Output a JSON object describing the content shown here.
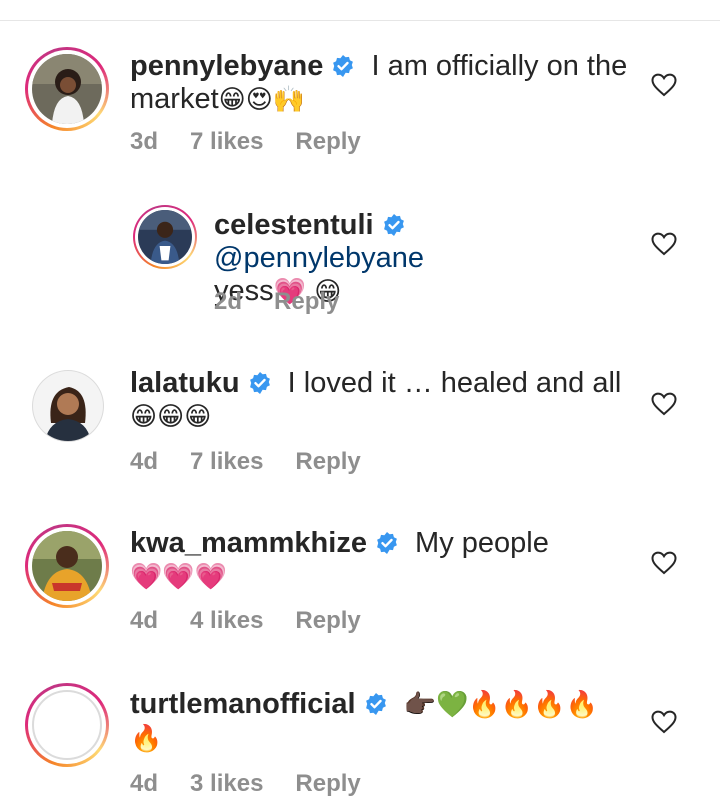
{
  "comments": [
    {
      "username": "pennylebyane",
      "text": "I am officially on the",
      "text2": "market",
      "emojis2": "😁😍🙌",
      "time": "3d",
      "likes": "7 likes",
      "reply": "Reply",
      "ring": true,
      "reply_to": ""
    },
    {
      "username": "celestentuli",
      "mention": "@pennylebyane",
      "text2": "yess",
      "emojis2": "💗 😁",
      "time": "2d",
      "reply": "Reply",
      "ring": true,
      "is_reply": true
    },
    {
      "username": "lalatuku",
      "text": "I loved it … healed and all",
      "emojis2": "😁😁😁",
      "time": "4d",
      "likes": "7 likes",
      "reply": "Reply",
      "ring": false
    },
    {
      "username": "kwa_mammkhize",
      "text": "My people",
      "emojis2": "💗💗💗",
      "time": "4d",
      "likes": "4 likes",
      "reply": "Reply",
      "ring": true
    },
    {
      "username": "turtlemanofficial",
      "emojis1": "👉🏿💚🔥🔥🔥🔥",
      "emojis2": "🔥",
      "time": "4d",
      "likes": "3 likes",
      "reply": "Reply",
      "ring": true
    }
  ],
  "colors": {
    "verified": "#3897f0",
    "mention": "#00376b",
    "meta": "#8e8e8e"
  },
  "icons": {
    "verified": "verified-badge-icon",
    "like": "heart-outline-icon"
  }
}
